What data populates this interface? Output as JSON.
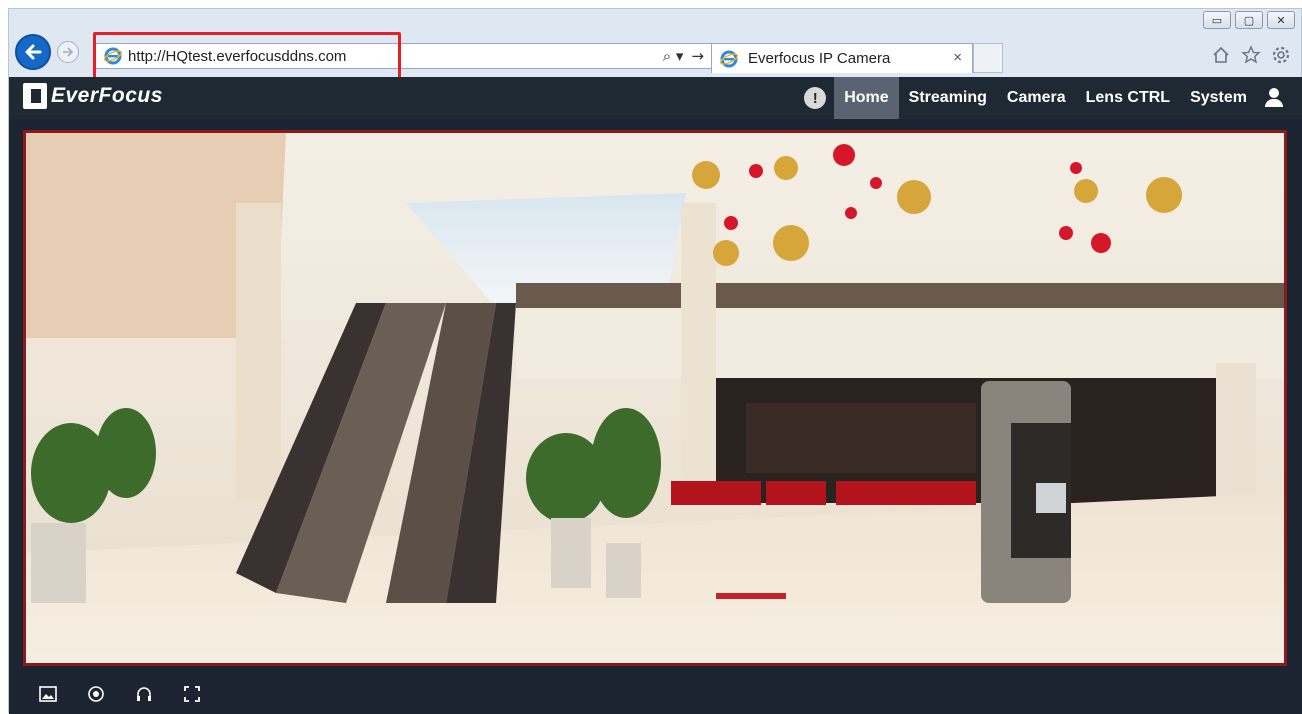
{
  "browser": {
    "url": "http://HQtest.everfocusddns.com",
    "tab_title": "Everfocus IP Camera",
    "tab_close": "×",
    "address_tools": [
      "⌕ ▾",
      "→"
    ],
    "window_controls": [
      "▭",
      "▢",
      "✕"
    ],
    "toolbar_icons": [
      "home-icon",
      "star-icon",
      "gear-icon"
    ]
  },
  "app": {
    "brand": "EverFocus",
    "menu": [
      {
        "label": "Home",
        "active": true
      },
      {
        "label": "Streaming",
        "active": false
      },
      {
        "label": "Camera",
        "active": false
      },
      {
        "label": "Lens CTRL",
        "active": false
      },
      {
        "label": "System",
        "active": false
      }
    ],
    "bottom_tools": [
      "snapshot-icon",
      "record-icon",
      "audio-icon",
      "fullscreen-icon"
    ]
  },
  "colors": {
    "highlight": "#e32028",
    "header_bg": "#1f2933",
    "active_menu": "#5a6470",
    "ie_blue": "#1769c9"
  }
}
